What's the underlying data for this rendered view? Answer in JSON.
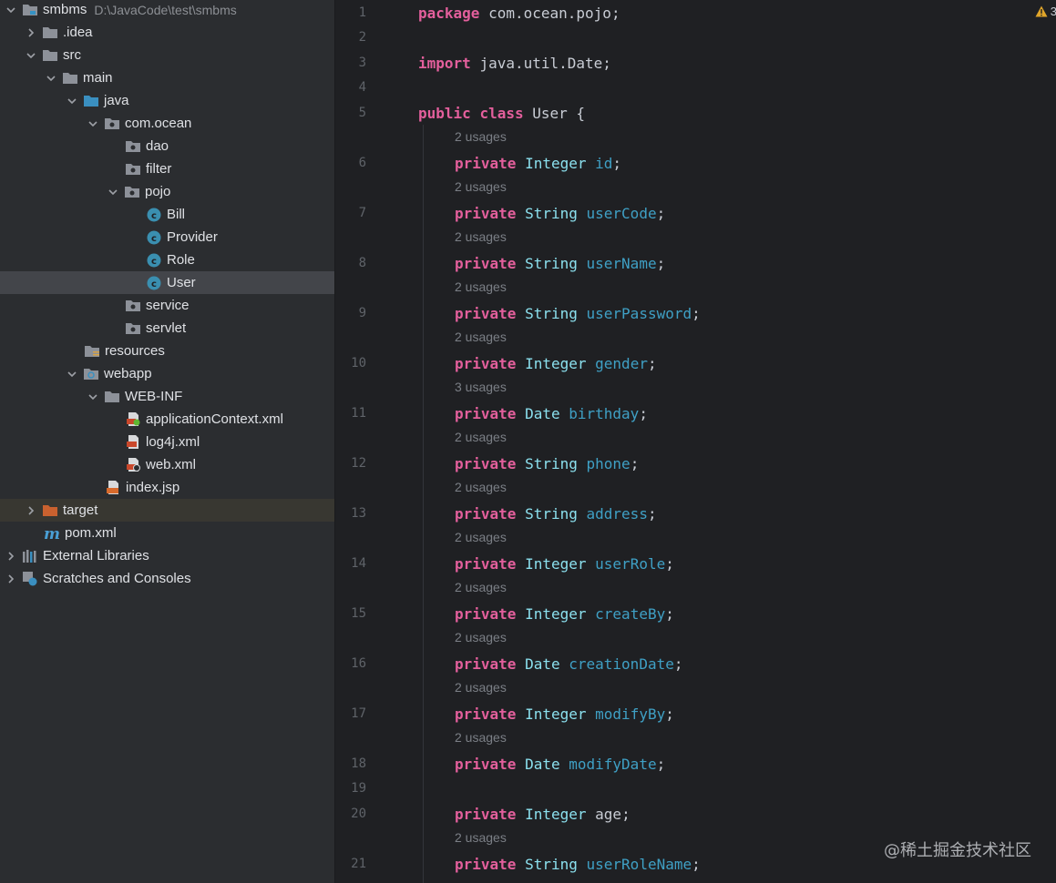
{
  "tree": {
    "root": {
      "label": "smbms",
      "path": "D:\\JavaCode\\test\\smbms"
    },
    "nodes": [
      {
        "label": ".idea"
      },
      {
        "label": "src"
      },
      {
        "label": "main"
      },
      {
        "label": "java"
      },
      {
        "label": "com.ocean"
      },
      {
        "label": "dao"
      },
      {
        "label": "filter"
      },
      {
        "label": "pojo"
      },
      {
        "label": "Bill"
      },
      {
        "label": "Provider"
      },
      {
        "label": "Role"
      },
      {
        "label": "User"
      },
      {
        "label": "service"
      },
      {
        "label": "servlet"
      },
      {
        "label": "resources"
      },
      {
        "label": "webapp"
      },
      {
        "label": "WEB-INF"
      },
      {
        "label": "applicationContext.xml"
      },
      {
        "label": "log4j.xml"
      },
      {
        "label": "web.xml"
      },
      {
        "label": "index.jsp"
      },
      {
        "label": "target"
      },
      {
        "label": "pom.xml"
      },
      {
        "label": "External Libraries"
      },
      {
        "label": "Scratches and Consoles"
      }
    ]
  },
  "editor": {
    "warnings": "3",
    "usages": {
      "two": "2 usages",
      "three": "3 usages"
    },
    "line_numbers": [
      "1",
      "2",
      "3",
      "4",
      "5",
      "6",
      "7",
      "8",
      "9",
      "10",
      "11",
      "12",
      "13",
      "14",
      "15",
      "16",
      "17",
      "18",
      "19",
      "20",
      "21"
    ],
    "keywords": {
      "package": "package",
      "import": "import",
      "public": "public",
      "class": "class",
      "private": "private"
    },
    "package_name": "com.ocean.pojo",
    "import_name": "java.util.Date",
    "class_name": "User",
    "fields": [
      {
        "type": "Integer",
        "name": "id"
      },
      {
        "type": "String",
        "name": "userCode"
      },
      {
        "type": "String",
        "name": "userName"
      },
      {
        "type": "String",
        "name": "userPassword"
      },
      {
        "type": "Integer",
        "name": "gender"
      },
      {
        "type": "Date",
        "name": "birthday"
      },
      {
        "type": "String",
        "name": "phone"
      },
      {
        "type": "String",
        "name": "address"
      },
      {
        "type": "Integer",
        "name": "userRole"
      },
      {
        "type": "Integer",
        "name": "createBy"
      },
      {
        "type": "Date",
        "name": "creationDate"
      },
      {
        "type": "Integer",
        "name": "modifyBy"
      },
      {
        "type": "Date",
        "name": "modifyDate"
      },
      {
        "type": "Integer",
        "name": "age"
      },
      {
        "type": "String",
        "name": "userRoleName"
      }
    ]
  },
  "watermark": "@稀土掘金技术社区",
  "colors": {
    "keyword": "#e35f9c",
    "type": "#8be0ee",
    "field": "#3fa0c5",
    "selection": "#43454a"
  }
}
